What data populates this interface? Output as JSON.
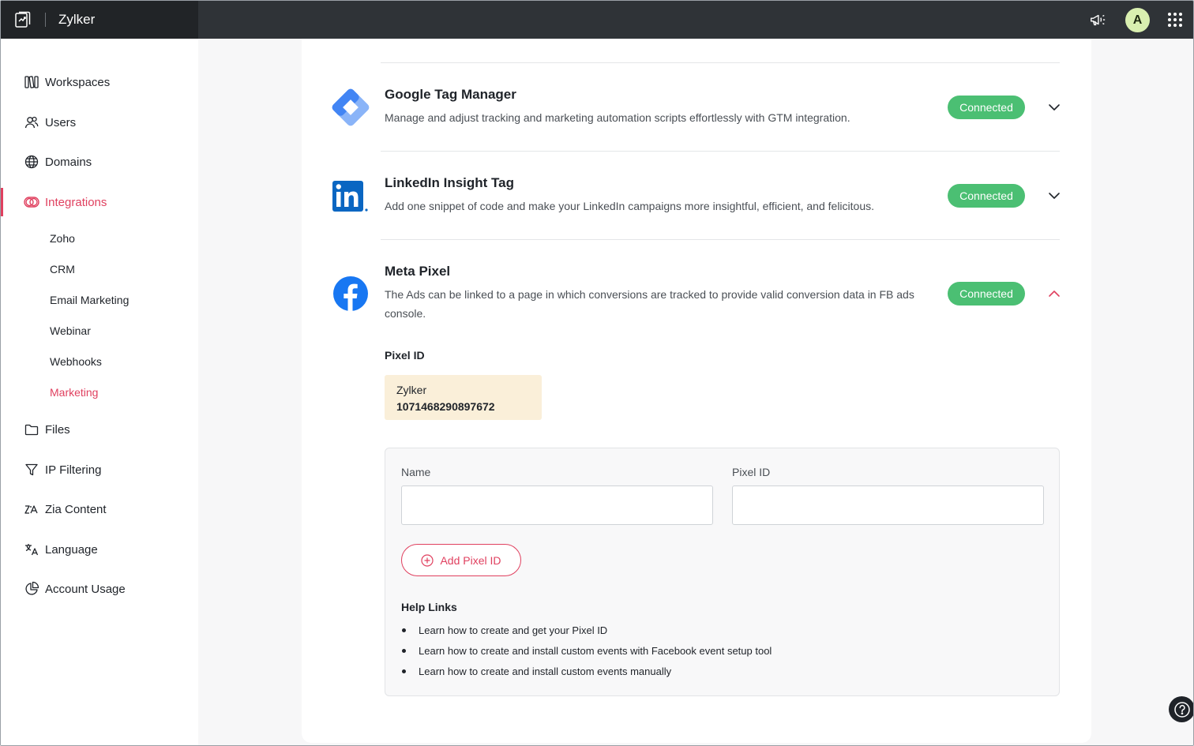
{
  "app": {
    "brand_name": "Zylker",
    "avatar_initial": "A"
  },
  "topbar": {
    "icons": [
      "logo-icon",
      "megaphone-icon",
      "avatar",
      "apps-grid-icon"
    ]
  },
  "sidebar": {
    "items": [
      {
        "label": "Workspaces",
        "icon": "workspaces-icon"
      },
      {
        "label": "Users",
        "icon": "users-icon"
      },
      {
        "label": "Domains",
        "icon": "globe-icon"
      },
      {
        "label": "Integrations",
        "icon": "integrations-icon",
        "active": true
      },
      {
        "label": "Files",
        "icon": "folder-icon"
      },
      {
        "label": "IP Filtering",
        "icon": "filter-icon"
      },
      {
        "label": "Zia Content",
        "icon": "zia-icon"
      },
      {
        "label": "Language",
        "icon": "language-icon"
      },
      {
        "label": "Account Usage",
        "icon": "pie-chart-icon"
      }
    ],
    "sub_items": [
      {
        "label": "Zoho"
      },
      {
        "label": "CRM"
      },
      {
        "label": "Email Marketing"
      },
      {
        "label": "Webinar"
      },
      {
        "label": "Webhooks"
      },
      {
        "label": "Marketing",
        "active": true
      }
    ]
  },
  "integrations": [
    {
      "title": "Google Tag Manager",
      "description": "Manage and adjust tracking and marketing automation scripts effortlessly with GTM integration.",
      "status": "Connected",
      "expanded": false,
      "icon": "google-tag-manager-icon"
    },
    {
      "title": "LinkedIn Insight Tag",
      "description": "Add one snippet of code and make your LinkedIn campaigns more insightful, efficient, and felicitous.",
      "status": "Connected",
      "expanded": false,
      "icon": "linkedin-icon"
    },
    {
      "title": "Meta Pixel",
      "description": "The Ads can be linked to a page in which conversions are tracked to provide valid conversion data in FB ads console.",
      "status": "Connected",
      "expanded": true,
      "icon": "facebook-icon"
    }
  ],
  "meta_pixel": {
    "pixel_id_heading": "Pixel ID",
    "saved_pixel": {
      "name": "Zylker",
      "id": "1071468290897672"
    },
    "form": {
      "name_label": "Name",
      "name_value": "",
      "pixel_id_label": "Pixel ID",
      "pixel_id_value": "",
      "add_button_label": "Add Pixel ID"
    },
    "help": {
      "title": "Help Links",
      "links": [
        "Learn how to create and get your Pixel ID",
        "Learn how to create and install custom events with Facebook event setup tool",
        "Learn how to create and install custom events manually"
      ]
    }
  },
  "colors": {
    "accent": "#e0405f",
    "connected": "#4bbf73",
    "topbar": "#2f3337",
    "pixel_chip": "#faefd9"
  }
}
